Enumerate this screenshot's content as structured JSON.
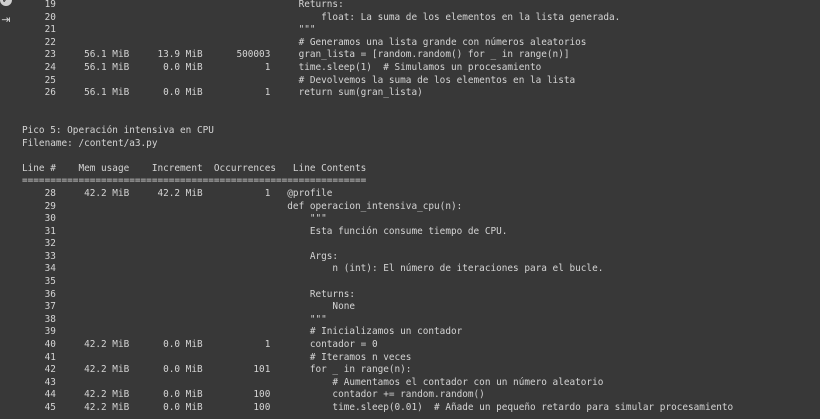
{
  "gutter": {
    "top_icon": "✓",
    "exit_icon": "⇥"
  },
  "output_lines": [
    "    19                                           Returns:",
    "    20                                               float: La suma de los elementos en la lista generada.",
    "    21                                           \"\"\"",
    "    22                                           # Generamos una lista grande con números aleatorios",
    "    23     56.1 MiB     13.9 MiB      500003     gran_lista = [random.random() for _ in range(n)]",
    "    24     56.1 MiB      0.0 MiB           1     time.sleep(1)  # Simulamos un procesamiento",
    "    25                                           # Devolvemos la suma de los elementos en la lista",
    "    26     56.1 MiB      0.0 MiB           1     return sum(gran_lista)",
    "",
    "",
    "Pico 5: Operación intensiva en CPU",
    "Filename: /content/a3.py",
    "",
    "Line #    Mem usage    Increment  Occurrences   Line Contents",
    "=============================================================",
    "    28     42.2 MiB     42.2 MiB           1   @profile",
    "    29                                         def operacion_intensiva_cpu(n):",
    "    30                                             \"\"\"",
    "    31                                             Esta función consume tiempo de CPU.",
    "    32",
    "    33                                             Args:",
    "    34                                                 n (int): El número de iteraciones para el bucle.",
    "    35",
    "    36                                             Returns:",
    "    37                                                 None",
    "    38                                             \"\"\"",
    "    39                                             # Inicializamos un contador",
    "    40     42.2 MiB      0.0 MiB           1       contador = 0",
    "    41                                             # Iteramos n veces",
    "    42     42.2 MiB      0.0 MiB         101       for _ in range(n):",
    "    43                                                 # Aumentamos el contador con un número aleatorio",
    "    44     42.2 MiB      0.0 MiB         100           contador += random.random()",
    "    45     42.2 MiB      0.0 MiB         100           time.sleep(0.01)  # Añade un pequeño retardo para simular procesamiento"
  ]
}
